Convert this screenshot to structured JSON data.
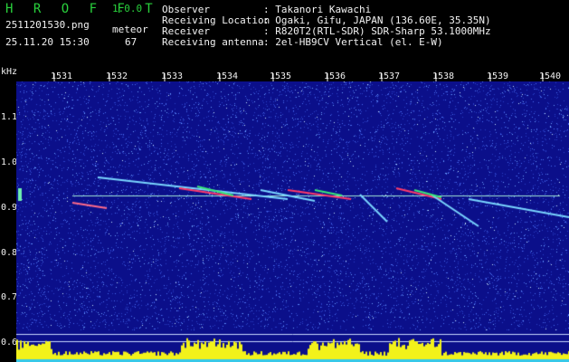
{
  "header": {
    "app_title": "H R O F F T",
    "app_version": "1.0.0",
    "file_name": "2511201530.png",
    "datetime": "25.11.20 15:30",
    "meteor_label": "meteor",
    "meteor_count": "67"
  },
  "info": [
    {
      "label": "Observer",
      "value": ": Takanori Kawachi"
    },
    {
      "label": "Receiving Location",
      "value": ": Ogaki, Gifu, JAPAN (136.60E, 35.35N)"
    },
    {
      "label": "Receiver",
      "value": ": R820T2(RTL-SDR) SDR-Sharp 53.1000MHz"
    },
    {
      "label": "Receiving antenna",
      "value": ": 2el-HB9CV Vertical (el. E-W)"
    }
  ],
  "axes": {
    "y_unit": "kHz",
    "x_ticks": [
      "1531",
      "1532",
      "1533",
      "1534",
      "1535",
      "1536",
      "1537",
      "1538",
      "1539",
      "1540"
    ],
    "y_ticks": [
      "1.1",
      "1.0",
      "0.9",
      "0.8",
      "0.7",
      "0.6"
    ]
  },
  "colors": {
    "background": "#000000",
    "spectrogram_base": "#0b0f8a",
    "title_green": "#29d13c",
    "carrier": "#9fe6d6",
    "signal_bar": "#f2f21a",
    "signal_base": "#36c8e8"
  }
}
